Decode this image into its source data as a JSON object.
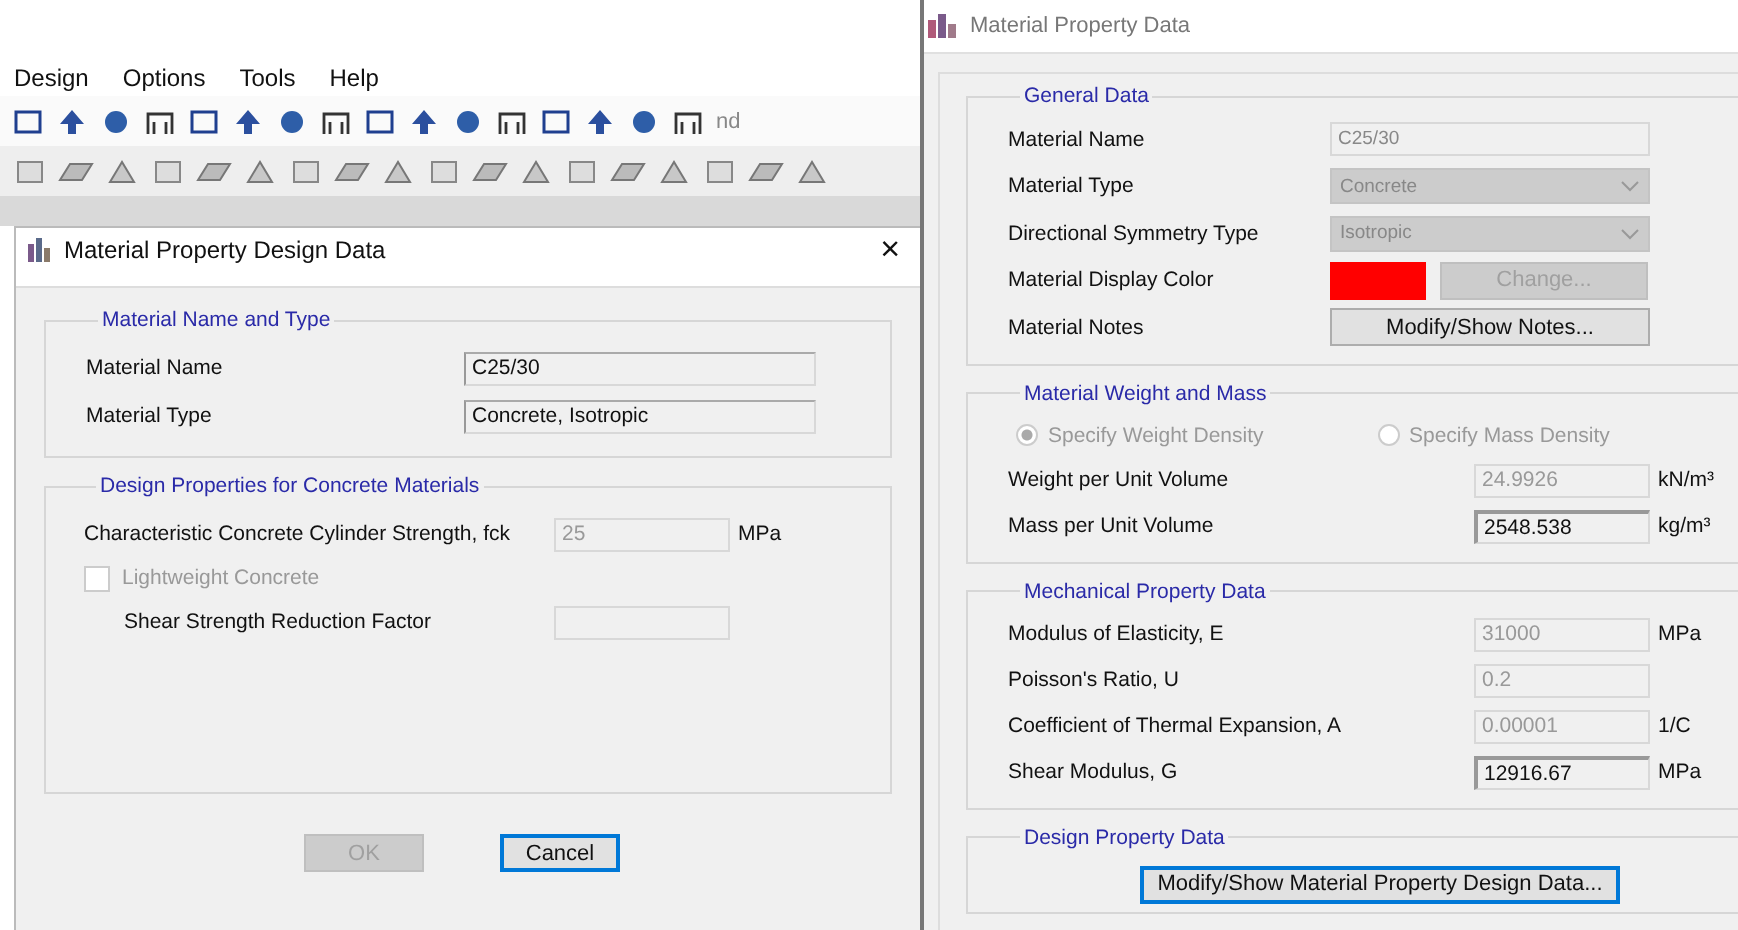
{
  "menu_bar": [
    {
      "label": "Design"
    },
    {
      "label": "Options"
    },
    {
      "label": "Tools"
    },
    {
      "label": "Help"
    }
  ],
  "toolbar_text": "nd",
  "design_dialog": {
    "title": "Material Property Design Data",
    "close": "×",
    "name_group": {
      "title": "Material Name and Type",
      "fields": [
        {
          "label": "Material Name",
          "value": "C25/30"
        },
        {
          "label": "Material Type",
          "value": "Concrete, Isotropic"
        }
      ]
    },
    "design_group": {
      "title": "Design Properties for Concrete Materials",
      "strength": {
        "label": "Characteristic Concrete Cylinder Strength, fck",
        "value": "25",
        "unit": "MPa",
        "disabled": true
      },
      "lightweight": {
        "label": "Lightweight Concrete",
        "checked": false,
        "disabled": true
      },
      "shear_factor": {
        "label": "Shear Strength Reduction Factor",
        "disabled": true
      }
    },
    "buttons": [
      {
        "label": "OK",
        "disabled": true,
        "focused": false
      },
      {
        "label": "Cancel",
        "disabled": false,
        "focused": true
      }
    ]
  },
  "property_dialog": {
    "title": "Material Property Data",
    "general": {
      "title": "General Data",
      "rows": [
        {
          "kind": "text",
          "label": "Material Name",
          "value": "C25/30",
          "disabled": true
        },
        {
          "kind": "dropdown",
          "label": "Material Type",
          "value": "Concrete",
          "disabled": true
        },
        {
          "kind": "dropdown",
          "label": "Directional Symmetry Type",
          "value": "Isotropic",
          "disabled": true
        },
        {
          "kind": "color",
          "label": "Material Display Color",
          "color": "#ff0000",
          "button": "Change...",
          "disabled": true
        },
        {
          "kind": "button",
          "label": "Material Notes",
          "button": "Modify/Show Notes...",
          "disabled": false
        }
      ]
    },
    "weight": {
      "title": "Material Weight and Mass",
      "radios": [
        {
          "label": "Specify Weight Density",
          "selected": true,
          "disabled": true
        },
        {
          "label": "Specify Mass Density",
          "selected": false,
          "disabled": true
        }
      ],
      "rows": [
        {
          "label": "Weight per Unit Volume",
          "value": "24.9926",
          "unit": "kN/m³",
          "disabled": true
        },
        {
          "label": "Mass per Unit Volume",
          "value": "2548.538",
          "unit": "kg/m³",
          "disabled": false
        }
      ]
    },
    "mechanical": {
      "title": "Mechanical Property Data",
      "rows": [
        {
          "label": "Modulus of Elasticity,  E",
          "value": "31000",
          "unit": "MPa",
          "disabled": true
        },
        {
          "label": "Poisson's Ratio,  U",
          "value": "0.2",
          "disabled": true
        },
        {
          "label": "Coefficient of Thermal Expansion,  A",
          "value": "0.00001",
          "unit": "1/C",
          "disabled": true
        },
        {
          "label": "Shear Modulus,  G",
          "value": "12916.67",
          "unit": "MPa",
          "disabled": false
        }
      ]
    },
    "design": {
      "title": "Design Property Data",
      "button": "Modify/Show Material Property Design Data...",
      "focused": true
    }
  }
}
